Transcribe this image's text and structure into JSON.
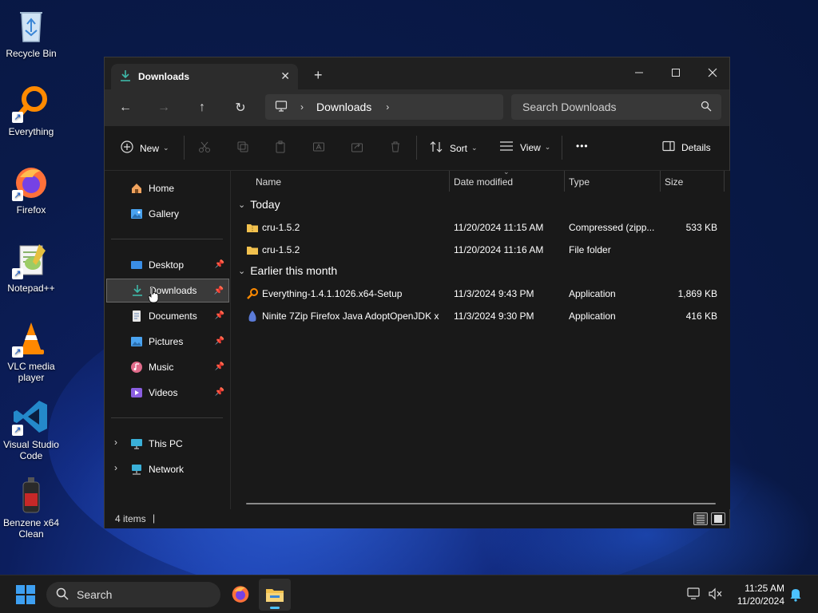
{
  "desktop": {
    "icons": [
      {
        "label": "Recycle Bin"
      },
      {
        "label": "Everything"
      },
      {
        "label": "Firefox"
      },
      {
        "label": "Notepad++"
      },
      {
        "label": "VLC media player"
      },
      {
        "label": "Visual Studio Code"
      },
      {
        "label": "Benzene x64 Clean"
      }
    ]
  },
  "window": {
    "tab_title": "Downloads",
    "new_tab": "+",
    "address": {
      "crumb": "Downloads"
    },
    "search": {
      "placeholder": "Search Downloads"
    },
    "commands": {
      "new": "New",
      "sort": "Sort",
      "view": "View",
      "more": "•••",
      "details": "Details"
    },
    "nav": {
      "quick": [
        {
          "label": "Home"
        },
        {
          "label": "Gallery"
        }
      ],
      "pinned": [
        {
          "label": "Desktop"
        },
        {
          "label": "Downloads"
        },
        {
          "label": "Documents"
        },
        {
          "label": "Pictures"
        },
        {
          "label": "Music"
        },
        {
          "label": "Videos"
        }
      ],
      "tree": [
        {
          "label": "This PC"
        },
        {
          "label": "Network"
        }
      ]
    },
    "columns": [
      "Name",
      "Date modified",
      "Type",
      "Size"
    ],
    "groups": [
      {
        "label": "Today",
        "rows": [
          {
            "name": "cru-1.5.2",
            "date": "11/20/2024 11:15 AM",
            "type": "Compressed (zipp...",
            "size": "533 KB"
          },
          {
            "name": "cru-1.5.2",
            "date": "11/20/2024 11:16 AM",
            "type": "File folder",
            "size": ""
          }
        ]
      },
      {
        "label": "Earlier this month",
        "rows": [
          {
            "name": "Everything-1.4.1.1026.x64-Setup",
            "date": "11/3/2024 9:43 PM",
            "type": "Application",
            "size": "1,869 KB"
          },
          {
            "name": "Ninite 7Zip Firefox Java AdoptOpenJDK x...",
            "date": "11/3/2024 9:30 PM",
            "type": "Application",
            "size": "416 KB"
          }
        ]
      }
    ],
    "status": {
      "count": "4 items",
      "sep": "|"
    }
  },
  "taskbar": {
    "search_label": "Search",
    "time": "11:25 AM",
    "date": "11/20/2024"
  },
  "colors": {
    "accent": "#0a84ff",
    "folder": "#f2c14e",
    "window_bg": "#191919",
    "toolbar_bg": "#2c2c2c"
  }
}
